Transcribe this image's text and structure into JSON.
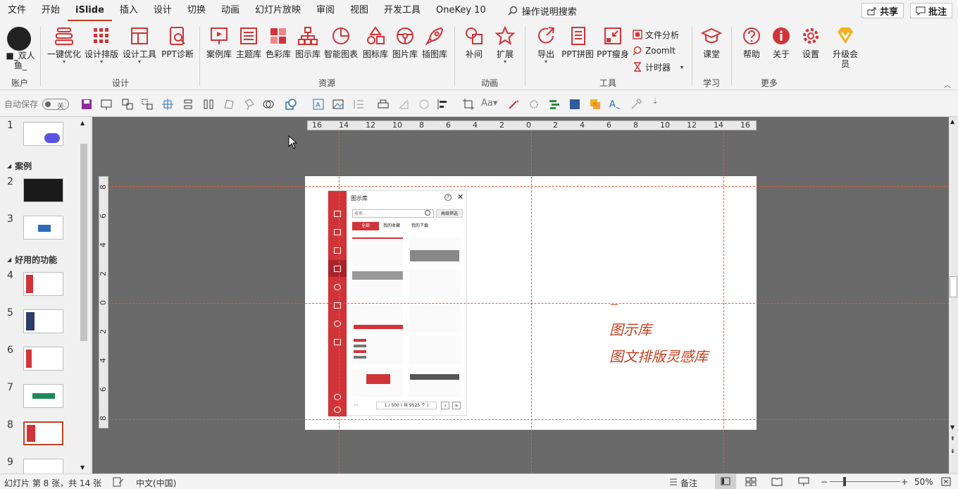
{
  "menu": {
    "tabs": [
      "文件",
      "开始",
      "iSlide",
      "插入",
      "设计",
      "切换",
      "动画",
      "幻灯片放映",
      "审阅",
      "视图",
      "开发工具",
      "OneKey 10"
    ],
    "active_tab": "iSlide",
    "search_text": "操作说明搜索",
    "share_label": "共享",
    "comment_label": "批注"
  },
  "ribbon": {
    "account": {
      "user": "■_双人鱼_",
      "group": "账户"
    },
    "design": {
      "group": "设计",
      "buttons": [
        "一键优化",
        "设计排版",
        "设计工具",
        "PPT诊断"
      ]
    },
    "resources": {
      "group": "资源",
      "buttons": [
        "案例库",
        "主题库",
        "色彩库",
        "图示库",
        "智能图表",
        "图标库",
        "图片库",
        "插图库"
      ]
    },
    "animation": {
      "group": "动画",
      "buttons": [
        "补间",
        "扩展"
      ]
    },
    "tools": {
      "group": "工具",
      "buttons": [
        "导出",
        "PPT拼图",
        "PPT瘦身"
      ],
      "small": [
        "文件分析",
        "ZoomIt",
        "计时器"
      ]
    },
    "learn": {
      "group": "学习",
      "buttons": [
        "课堂"
      ]
    },
    "more": {
      "group": "更多",
      "buttons": [
        "帮助",
        "关于",
        "设置"
      ],
      "upgrade": "升级会员"
    }
  },
  "quickbar": {
    "autosave_label": "自动保存",
    "toggle_state": "关"
  },
  "thumbnails": {
    "sections": [
      "案例",
      "好用的功能"
    ],
    "slides": [
      "1",
      "2",
      "3",
      "4",
      "5",
      "6",
      "7",
      "8",
      "9"
    ],
    "selected": "8"
  },
  "rulers": {
    "h": [
      "16",
      "14",
      "12",
      "10",
      "8",
      "6",
      "4",
      "2",
      "0",
      "2",
      "4",
      "6",
      "8",
      "10",
      "12",
      "14",
      "16"
    ],
    "v": [
      "8",
      "6",
      "4",
      "2",
      "0",
      "2",
      "4",
      "6",
      "8"
    ]
  },
  "slide": {
    "title": "图示库",
    "subtitle": "图文排版灵感库",
    "panel": {
      "title": "图示库",
      "search_placeholder": "搜索...",
      "filter_button": "高级筛选",
      "tabs": [
        "全部",
        "我的收藏",
        "我的下载"
      ],
      "pager": "1 / 500 ( 共 9525 个 )"
    }
  },
  "status": {
    "slide_info": "幻灯片 第 8 张，共 14 张",
    "language": "中文(中国)",
    "notes": "备注",
    "zoom": "50%"
  },
  "colors": {
    "accent": "#c43e1c",
    "brand_red": "#d13438",
    "canvas": "#6a6a6a"
  }
}
